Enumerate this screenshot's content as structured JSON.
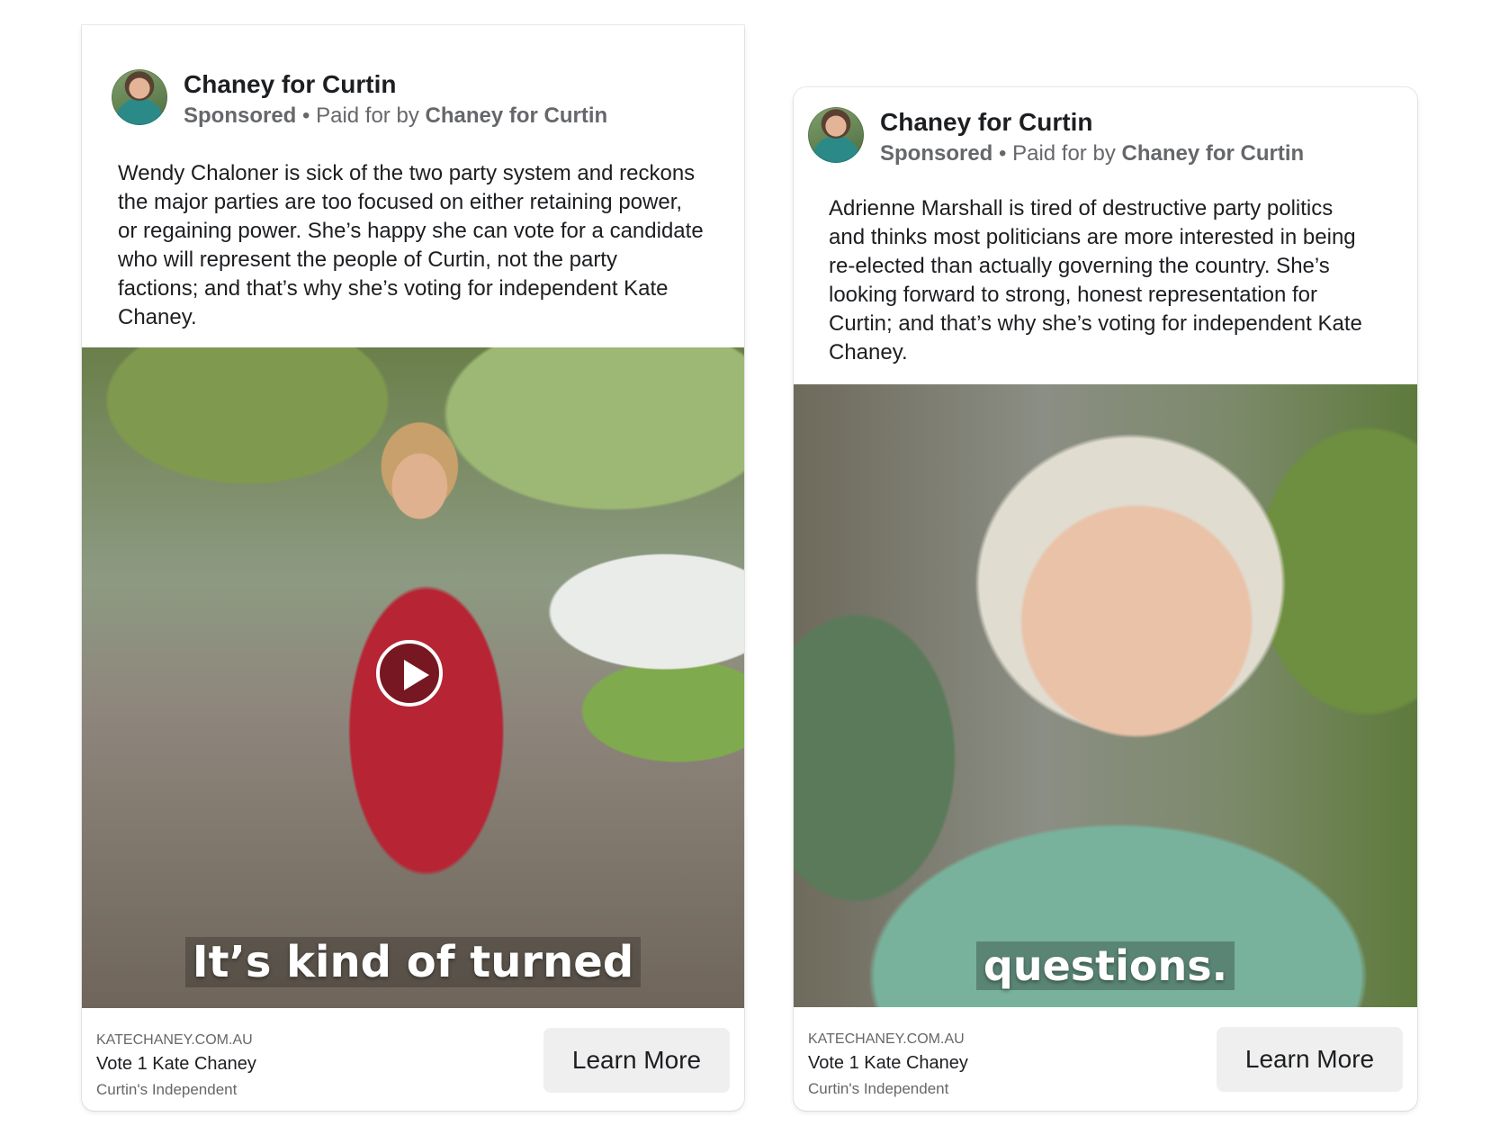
{
  "ads": [
    {
      "page_name": "Chaney for Curtin",
      "sponsored_label": "Sponsored",
      "paid_for_prefix": "• Paid for by",
      "paid_for_by": "Chaney for Curtin",
      "body": "Wendy Chaloner is sick of the two party system and reckons\nthe major parties are too focused on either retaining power,\nor regaining power.  She’s happy she can vote for a candidate\nwho will represent the people of Curtin, not the party\nfactions; and that’s why she’s voting for independent Kate\nChaney.",
      "video_caption": "It’s kind of turned",
      "domain": "KATECHANEY.COM.AU",
      "headline": "Vote 1 Kate Chaney",
      "description": "Curtin's Independent",
      "cta_label": "Learn More"
    },
    {
      "page_name": "Chaney for Curtin",
      "sponsored_label": "Sponsored",
      "paid_for_prefix": "• Paid for by",
      "paid_for_by": "Chaney for Curtin",
      "body": "Adrienne Marshall is tired of destructive party politics\nand thinks most politicians are more interested in being\nre-elected than actually governing the country.  She’s\nlooking forward to strong, honest representation for\nCurtin; and that’s why she’s voting for independent Kate\nChaney.",
      "video_caption": "questions.",
      "domain": "KATECHANEY.COM.AU",
      "headline": "Vote 1 Kate Chaney",
      "description": "Curtin's Independent",
      "cta_label": "Learn More"
    }
  ],
  "colors": {
    "text_primary": "#1c1e21",
    "text_secondary": "#65676b",
    "cta_background": "#efefef"
  }
}
